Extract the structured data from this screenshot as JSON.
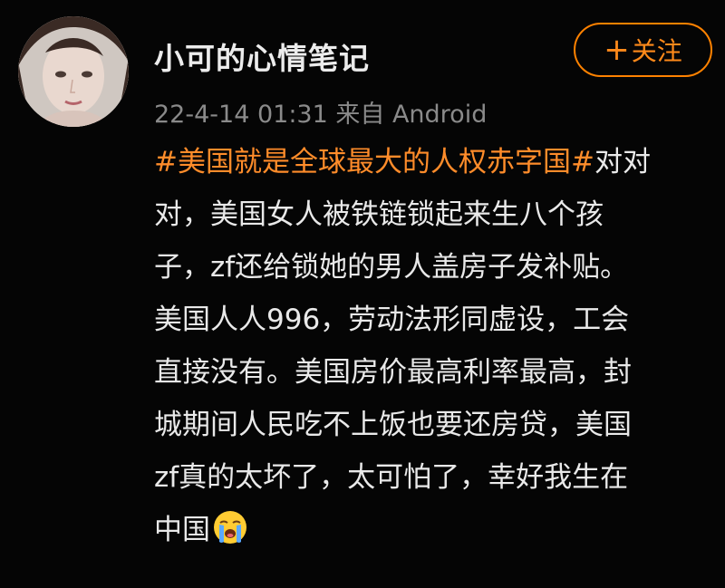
{
  "post": {
    "username": "小可的心情笔记",
    "timestamp": "22-4-14 01:31",
    "source": "来自 Android",
    "follow_button": {
      "plus": "+",
      "label": "关注"
    },
    "hashtag": "#美国就是全球最大的人权赤字国#",
    "lines": [
      "对对",
      "对，美国女人被铁链锁起来生八个孩",
      "子，zf还给锁她的男人盖房子发补贴。",
      "美国人人996，劳动法形同虚设，工会",
      "直接没有。美国房价最高利率最高，封",
      "城期间人民吃不上饭也要还房贷，美国",
      "zf真的太坏了，太可怕了，幸好我生在",
      "中国"
    ],
    "emoji_icon": "loudly-crying-face-emoji",
    "colors": {
      "accent": "#ff8200",
      "hashtag": "#ff8c2a",
      "background": "#050505",
      "meta_text": "#8a8a8a"
    }
  }
}
